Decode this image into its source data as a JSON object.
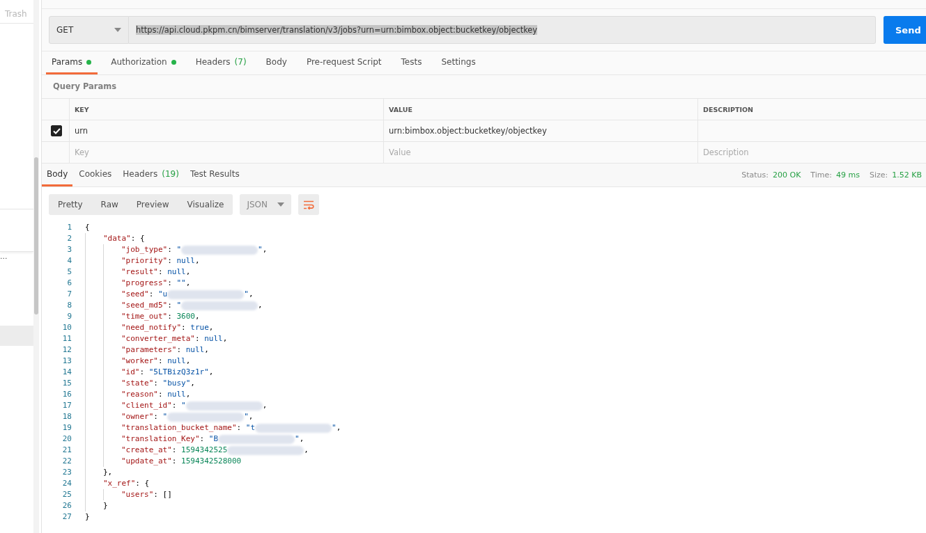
{
  "sidebar": {
    "tab": "Trash",
    "rows": [
      {
        "label": "...",
        "selected": false
      },
      {
        "selected": true
      }
    ]
  },
  "request": {
    "method": "GET",
    "url": "https://api.cloud.pkpm.cn/bimserver/translation/v3/jobs?urn=urn:bimbox.object:bucketkey/objectkey",
    "url_selected": true,
    "send": "Send"
  },
  "request_tabs": [
    {
      "label": "Params",
      "dot": true,
      "selected": true
    },
    {
      "label": "Authorization",
      "dot": true,
      "selected": false
    },
    {
      "label": "Headers",
      "count": "(7)",
      "dot": false,
      "selected": false
    },
    {
      "label": "Body",
      "dot": false,
      "selected": false
    },
    {
      "label": "Pre-request Script",
      "dot": false,
      "selected": false
    },
    {
      "label": "Tests",
      "dot": false,
      "selected": false
    },
    {
      "label": "Settings",
      "dot": false,
      "selected": false
    }
  ],
  "params": {
    "title": "Query Params",
    "columns": [
      "KEY",
      "VALUE",
      "DESCRIPTION"
    ],
    "rows": [
      {
        "checked": true,
        "key": "urn",
        "value": "urn:bimbox.object:bucketkey/objectkey"
      }
    ],
    "new_row": [
      {
        "placeholder": "Key"
      },
      {
        "placeholder": "Value"
      },
      {
        "placeholder": "Description"
      }
    ]
  },
  "response": {
    "tabs": [
      {
        "label": "Body",
        "selected": true
      },
      {
        "label": "Cookies",
        "selected": false
      },
      {
        "label": "Headers",
        "count": "(19)",
        "selected": false
      },
      {
        "label": "Test Results",
        "selected": false
      }
    ],
    "stats": [
      {
        "label": "Status:",
        "value": "200 OK"
      },
      {
        "label": "Time:",
        "value": "49 ms"
      },
      {
        "label": "Size:",
        "value": "1.52 KB"
      }
    ],
    "view_modes": [
      "Pretty",
      "Raw",
      "Preview",
      "Visualize"
    ],
    "format": "JSON",
    "code": [
      {
        "num": "1",
        "parts": [
          {
            "kind": "punct",
            "text": "{"
          }
        ],
        "children": [
          {
            "num": "2",
            "parts": [
              {
                "kind": "key",
                "text": "\"data\""
              },
              {
                "kind": "punct",
                "text": ": {"
              }
            ],
            "children": [
              {
                "num": "3",
                "parts": [
                  {
                    "kind": "key",
                    "text": "\"job_type\""
                  },
                  {
                    "kind": "punct",
                    "text": ": "
                  },
                  {
                    "kind": "string",
                    "text": "\""
                  },
                  {
                    "kind": "redacted"
                  },
                  {
                    "kind": "string",
                    "text": "\""
                  },
                  {
                    "kind": "punct",
                    "text": ","
                  }
                ]
              },
              {
                "num": "4",
                "parts": [
                  {
                    "kind": "key",
                    "text": "\"priority\""
                  },
                  {
                    "kind": "punct",
                    "text": ": "
                  },
                  {
                    "kind": "literal",
                    "text": "null"
                  },
                  {
                    "kind": "punct",
                    "text": ","
                  }
                ]
              },
              {
                "num": "5",
                "parts": [
                  {
                    "kind": "key",
                    "text": "\"result\""
                  },
                  {
                    "kind": "punct",
                    "text": ": "
                  },
                  {
                    "kind": "literal",
                    "text": "null"
                  },
                  {
                    "kind": "punct",
                    "text": ","
                  }
                ]
              },
              {
                "num": "6",
                "parts": [
                  {
                    "kind": "key",
                    "text": "\"progress\""
                  },
                  {
                    "kind": "punct",
                    "text": ": "
                  },
                  {
                    "kind": "string",
                    "text": "\"\""
                  },
                  {
                    "kind": "punct",
                    "text": ","
                  }
                ]
              },
              {
                "num": "7",
                "parts": [
                  {
                    "kind": "key",
                    "text": "\"seed\""
                  },
                  {
                    "kind": "punct",
                    "text": ": "
                  },
                  {
                    "kind": "string",
                    "text": "\"u"
                  },
                  {
                    "kind": "redacted"
                  },
                  {
                    "kind": "string",
                    "text": "\""
                  },
                  {
                    "kind": "punct",
                    "text": ","
                  }
                ]
              },
              {
                "num": "8",
                "parts": [
                  {
                    "kind": "key",
                    "text": "\"seed_md5\""
                  },
                  {
                    "kind": "punct",
                    "text": ": "
                  },
                  {
                    "kind": "string",
                    "text": "\""
                  },
                  {
                    "kind": "redacted"
                  },
                  {
                    "kind": "punct",
                    "text": ","
                  }
                ]
              },
              {
                "num": "9",
                "parts": [
                  {
                    "kind": "key",
                    "text": "\"time_out\""
                  },
                  {
                    "kind": "punct",
                    "text": ": "
                  },
                  {
                    "kind": "number",
                    "text": "3600"
                  },
                  {
                    "kind": "punct",
                    "text": ","
                  }
                ]
              },
              {
                "num": "10",
                "parts": [
                  {
                    "kind": "key",
                    "text": "\"need_notify\""
                  },
                  {
                    "kind": "punct",
                    "text": ": "
                  },
                  {
                    "kind": "literal",
                    "text": "true"
                  },
                  {
                    "kind": "punct",
                    "text": ","
                  }
                ]
              },
              {
                "num": "11",
                "parts": [
                  {
                    "kind": "key",
                    "text": "\"converter_meta\""
                  },
                  {
                    "kind": "punct",
                    "text": ": "
                  },
                  {
                    "kind": "literal",
                    "text": "null"
                  },
                  {
                    "kind": "punct",
                    "text": ","
                  }
                ]
              },
              {
                "num": "12",
                "parts": [
                  {
                    "kind": "key",
                    "text": "\"parameters\""
                  },
                  {
                    "kind": "punct",
                    "text": ": "
                  },
                  {
                    "kind": "literal",
                    "text": "null"
                  },
                  {
                    "kind": "punct",
                    "text": ","
                  }
                ]
              },
              {
                "num": "13",
                "parts": [
                  {
                    "kind": "key",
                    "text": "\"worker\""
                  },
                  {
                    "kind": "punct",
                    "text": ": "
                  },
                  {
                    "kind": "literal",
                    "text": "null"
                  },
                  {
                    "kind": "punct",
                    "text": ","
                  }
                ]
              },
              {
                "num": "14",
                "parts": [
                  {
                    "kind": "key",
                    "text": "\"id\""
                  },
                  {
                    "kind": "punct",
                    "text": ": "
                  },
                  {
                    "kind": "string",
                    "text": "\"5LTBizQ3z1r\""
                  },
                  {
                    "kind": "punct",
                    "text": ","
                  }
                ]
              },
              {
                "num": "15",
                "parts": [
                  {
                    "kind": "key",
                    "text": "\"state\""
                  },
                  {
                    "kind": "punct",
                    "text": ": "
                  },
                  {
                    "kind": "string",
                    "text": "\"busy\""
                  },
                  {
                    "kind": "punct",
                    "text": ","
                  }
                ]
              },
              {
                "num": "16",
                "parts": [
                  {
                    "kind": "key",
                    "text": "\"reason\""
                  },
                  {
                    "kind": "punct",
                    "text": ": "
                  },
                  {
                    "kind": "literal",
                    "text": "null"
                  },
                  {
                    "kind": "punct",
                    "text": ","
                  }
                ]
              },
              {
                "num": "17",
                "parts": [
                  {
                    "kind": "key",
                    "text": "\"client_id\""
                  },
                  {
                    "kind": "punct",
                    "text": ": "
                  },
                  {
                    "kind": "string",
                    "text": "\""
                  },
                  {
                    "kind": "redacted"
                  },
                  {
                    "kind": "punct",
                    "text": ","
                  }
                ]
              },
              {
                "num": "18",
                "parts": [
                  {
                    "kind": "key",
                    "text": "\"owner\""
                  },
                  {
                    "kind": "punct",
                    "text": ": "
                  },
                  {
                    "kind": "string",
                    "text": "\""
                  },
                  {
                    "kind": "redacted"
                  },
                  {
                    "kind": "string",
                    "text": "\""
                  },
                  {
                    "kind": "punct",
                    "text": ","
                  }
                ]
              },
              {
                "num": "19",
                "parts": [
                  {
                    "kind": "key",
                    "text": "\"translation_bucket_name\""
                  },
                  {
                    "kind": "punct",
                    "text": ": "
                  },
                  {
                    "kind": "string",
                    "text": "\"t"
                  },
                  {
                    "kind": "redacted"
                  },
                  {
                    "kind": "string",
                    "text": "\""
                  },
                  {
                    "kind": "punct",
                    "text": ","
                  }
                ]
              },
              {
                "num": "20",
                "parts": [
                  {
                    "kind": "key",
                    "text": "\"translation_Key\""
                  },
                  {
                    "kind": "punct",
                    "text": ": "
                  },
                  {
                    "kind": "string",
                    "text": "\"B"
                  },
                  {
                    "kind": "redacted"
                  },
                  {
                    "kind": "string",
                    "text": "\""
                  },
                  {
                    "kind": "punct",
                    "text": ","
                  }
                ]
              },
              {
                "num": "21",
                "parts": [
                  {
                    "kind": "key",
                    "text": "\"create_at\""
                  },
                  {
                    "kind": "punct",
                    "text": ": "
                  },
                  {
                    "kind": "number",
                    "text": "1594342525"
                  },
                  {
                    "kind": "redacted"
                  },
                  {
                    "kind": "punct",
                    "text": ","
                  }
                ]
              },
              {
                "num": "22",
                "parts": [
                  {
                    "kind": "key",
                    "text": "\"update_at\""
                  },
                  {
                    "kind": "punct",
                    "text": ": "
                  },
                  {
                    "kind": "number",
                    "text": "1594342528000"
                  }
                ]
              }
            ]
          },
          {
            "num": "23",
            "parts": [
              {
                "kind": "punct",
                "text": "},"
              }
            ]
          },
          {
            "num": "24",
            "parts": [
              {
                "kind": "key",
                "text": "\"x_ref\""
              },
              {
                "kind": "punct",
                "text": ": {"
              }
            ],
            "children": [
              {
                "num": "25",
                "parts": [
                  {
                    "kind": "key",
                    "text": "\"users\""
                  },
                  {
                    "kind": "punct",
                    "text": ": []"
                  }
                ]
              }
            ]
          },
          {
            "num": "26",
            "parts": [
              {
                "kind": "punct",
                "text": "}"
              }
            ]
          }
        ]
      },
      {
        "num": "27",
        "parts": [
          {
            "kind": "punct",
            "text": "}"
          }
        ]
      }
    ]
  }
}
